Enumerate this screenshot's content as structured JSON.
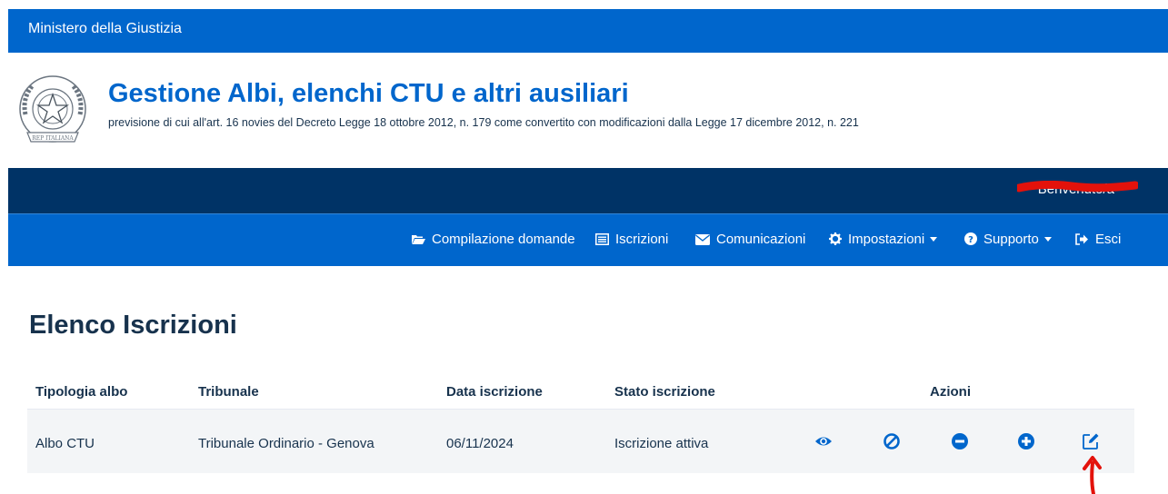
{
  "top_bar": {
    "title": "Ministero della Giustizia"
  },
  "header": {
    "title": "Gestione Albi, elenchi CTU e altri ausiliari",
    "subtitle": "previsione di cui all'art. 16 novies del Decreto Legge 18 ottobre 2012, n. 179 come convertito con modificazioni dalla Legge 17 dicembre 2012, n. 221"
  },
  "user_bar": {
    "welcome": "Benvenuto/a"
  },
  "nav": {
    "compilazione": "Compilazione domande",
    "iscrizioni": "Iscrizioni",
    "comunicazioni": "Comunicazioni",
    "impostazioni": "Impostazioni",
    "supporto": "Supporto",
    "esci": "Esci"
  },
  "page": {
    "title": "Elenco Iscrizioni"
  },
  "table": {
    "headers": [
      "Tipologia albo",
      "Tribunale",
      "Data iscrizione",
      "Stato iscrizione",
      "Azioni"
    ],
    "rows": [
      [
        "Albo CTU",
        "Tribunale Ordinario - Genova",
        "06/11/2024",
        "Iscrizione attiva"
      ]
    ],
    "action_icons": [
      "eye-icon",
      "ban-icon",
      "minus-circle-icon",
      "plus-circle-icon",
      "edit-icon"
    ]
  },
  "colors": {
    "primary": "#0066cc",
    "dark": "#003366",
    "text": "#17324d",
    "row_bg": "#f3f5f7",
    "annotation": "#e3120b"
  }
}
